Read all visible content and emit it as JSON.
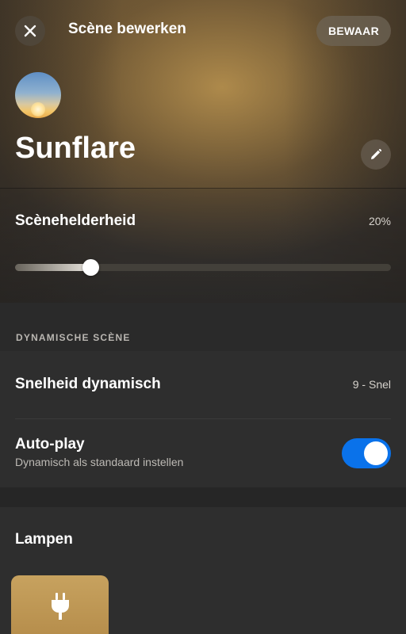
{
  "header": {
    "title": "Scène bewerken",
    "save_label": "BEWAAR",
    "close_icon": "close-icon"
  },
  "scene": {
    "name": "Sunflare",
    "edit_icon": "pencil-icon"
  },
  "brightness": {
    "label": "Scènehelderheid",
    "value_text": "20%",
    "value_fraction": 0.2
  },
  "dynamic": {
    "section_title": "DYNAMISCHE SCÈNE",
    "speed_label": "Snelheid dynamisch",
    "speed_value": "9 - Snel",
    "autoplay_label": "Auto-play",
    "autoplay_sub": "Dynamisch als standaard instellen",
    "autoplay_on": true
  },
  "lamps": {
    "label": "Lampen",
    "tile_icon": "plug-icon"
  },
  "colors": {
    "toggle_on": "#0a72ea",
    "lamp_tile": "#c7a25f"
  }
}
